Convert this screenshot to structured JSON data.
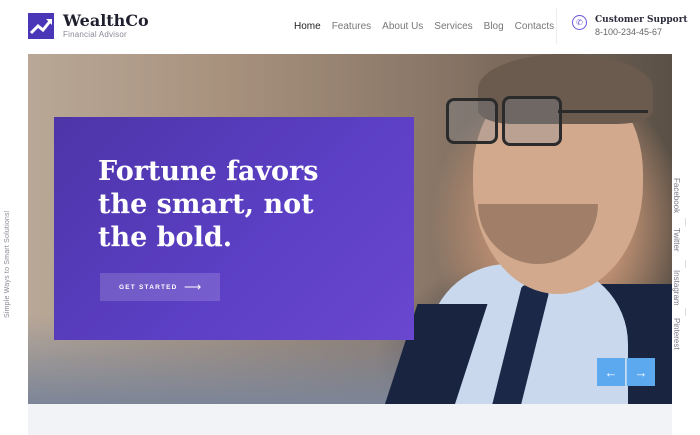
{
  "brand": {
    "name": "WealthCo",
    "tagline": "Financial Advisor"
  },
  "nav": {
    "items": [
      "Home",
      "Features",
      "About Us",
      "Services",
      "Blog",
      "Contacts"
    ],
    "active": "Home"
  },
  "support": {
    "label": "Customer Support",
    "phone": "8-100-234-45-67",
    "icon": "phone-icon"
  },
  "hero": {
    "headline": "Fortune favors the smart, not the bold.",
    "cta": "GET STARTED",
    "prev_arrow": "←",
    "next_arrow": "→"
  },
  "side_text": "Simple Ways to Smart Solutions!",
  "social": [
    "Facebook",
    "Twitter",
    "Instagram",
    "Pinterest"
  ],
  "colors": {
    "accent": "#5b3fc4",
    "arrow_buttons": "#5da9f0"
  }
}
